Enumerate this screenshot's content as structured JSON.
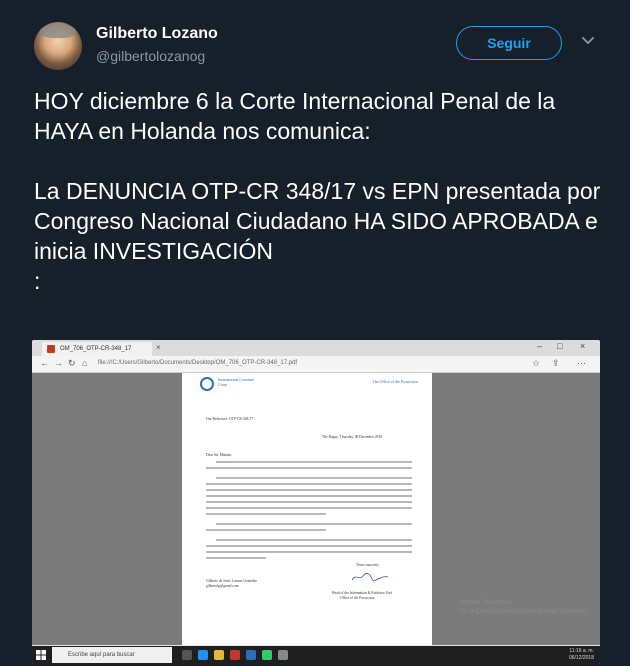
{
  "author": {
    "display_name": "Gilberto Lozano",
    "handle": "@gilbertolozanog"
  },
  "actions": {
    "follow_label": "Seguir",
    "more_icon": "chevron-down-icon"
  },
  "tweet": {
    "text": "HOY diciembre 6  la Corte Internacional Penal de la HAYA en Holanda nos comunica:\n\nLa DENUNCIA OTP-CR 348/17 vs EPN presentada por Congreso Nacional Ciudadano HA SIDO APROBADA e inicia INVESTIGACIÓN\n:"
  },
  "media": {
    "browser_tab": "OM_706_OTP-CR-348_17",
    "address": "file:///C:/Users/Gilberto/Documents/Desktop/OM_706_OTP-CR-348_17.pdf",
    "document": {
      "org_name": "International Criminal Court",
      "office": "The Office of the Prosecutor",
      "reference": "Our Reference:   OTP-CR-348/17",
      "date_line": "The Hague, Thursday, 06 December 2018",
      "salutation": "Dear Sir, Madam,",
      "signoff": "Yours sincerely,",
      "recipient": "Gilberto de Jesús Lozano González",
      "recipient_email": "gilbertolg@gmail.com",
      "signer_unit": "Head of the Information & Evidence Unit",
      "signer_office": "Office of the Prosecutor"
    },
    "watermark": {
      "line1": "Activar Windows",
      "line2": "Ve a Configuración para activar Windows."
    },
    "taskbar": {
      "search_placeholder": "Escribe aquí para buscar",
      "time": "11:16 a. m.",
      "date": "06/12/2018"
    }
  }
}
